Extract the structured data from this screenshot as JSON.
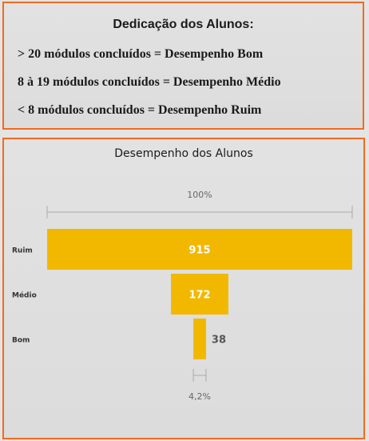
{
  "legend": {
    "title": "Dedicação dos Alunos:",
    "lines": [
      "> 20 módulos concluídos = Desempenho Bom",
      "8 à 19 módulos concluídos = Desempenho Médio",
      "< 8 módulos concluídos = Desempenho Ruim"
    ]
  },
  "chart_data": {
    "type": "funnel",
    "title": "Desempenho dos Alunos",
    "categories": [
      "Ruim",
      "Médio",
      "Bom"
    ],
    "values": [
      915,
      172,
      38
    ],
    "top_percent_label": "100%",
    "bottom_percent_label": "4,2%",
    "colors": {
      "bar": "#f2b800",
      "label_inside": "#ffffff",
      "label_outside": "#555555",
      "category_label": "#333333",
      "bracket": "#aaaaaa",
      "border": "#f26a21"
    }
  }
}
